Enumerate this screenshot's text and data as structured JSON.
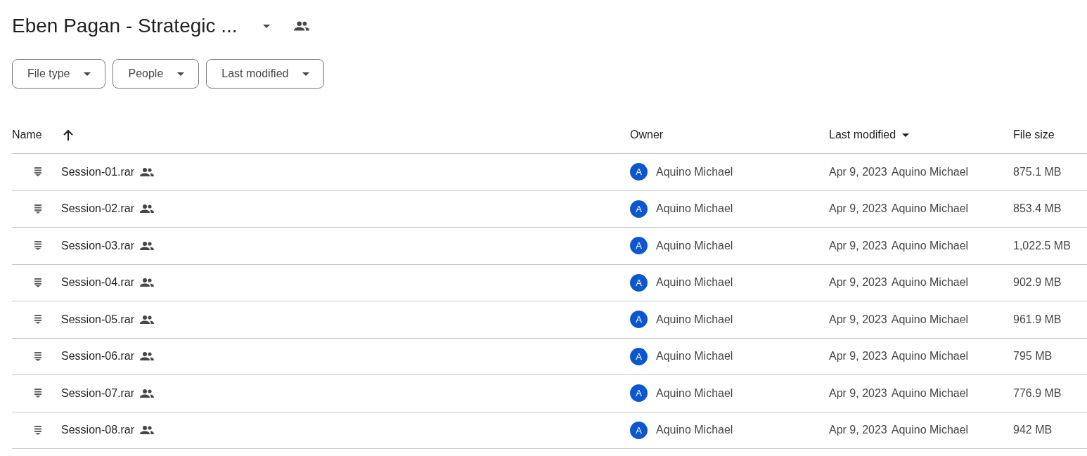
{
  "folder": {
    "title": "Eben Pagan - Strategic ..."
  },
  "filters": [
    {
      "label": "File type"
    },
    {
      "label": "People"
    },
    {
      "label": "Last modified"
    }
  ],
  "table": {
    "columns": [
      {
        "label": "Name",
        "kind": "name"
      },
      {
        "label": "Owner",
        "kind": "plain"
      },
      {
        "label": "Last modified",
        "kind": "sorted"
      },
      {
        "label": "File size",
        "kind": "plain"
      }
    ],
    "rows": [
      {
        "name": "Session-01.rar",
        "avatar": "A",
        "owner": "Aquino Michael",
        "date": "Apr 9, 2023",
        "modified_by": "Aquino Michael",
        "size": "875.1 MB"
      },
      {
        "name": "Session-02.rar",
        "avatar": "A",
        "owner": "Aquino Michael",
        "date": "Apr 9, 2023",
        "modified_by": "Aquino Michael",
        "size": "853.4 MB"
      },
      {
        "name": "Session-03.rar",
        "avatar": "A",
        "owner": "Aquino Michael",
        "date": "Apr 9, 2023",
        "modified_by": "Aquino Michael",
        "size": "1,022.5 MB"
      },
      {
        "name": "Session-04.rar",
        "avatar": "A",
        "owner": "Aquino Michael",
        "date": "Apr 9, 2023",
        "modified_by": "Aquino Michael",
        "size": "902.9 MB"
      },
      {
        "name": "Session-05.rar",
        "avatar": "A",
        "owner": "Aquino Michael",
        "date": "Apr 9, 2023",
        "modified_by": "Aquino Michael",
        "size": "961.9 MB"
      },
      {
        "name": "Session-06.rar",
        "avatar": "A",
        "owner": "Aquino Michael",
        "date": "Apr 9, 2023",
        "modified_by": "Aquino Michael",
        "size": "795 MB"
      },
      {
        "name": "Session-07.rar",
        "avatar": "A",
        "owner": "Aquino Michael",
        "date": "Apr 9, 2023",
        "modified_by": "Aquino Michael",
        "size": "776.9 MB"
      },
      {
        "name": "Session-08.rar",
        "avatar": "A",
        "owner": "Aquino Michael",
        "date": "Apr 9, 2023",
        "modified_by": "Aquino Michael",
        "size": "942 MB"
      }
    ]
  }
}
